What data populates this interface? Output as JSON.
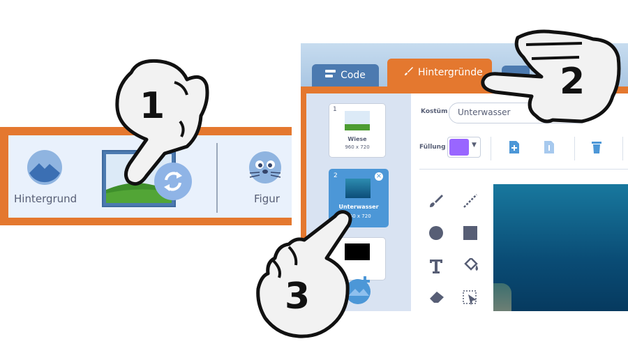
{
  "left_panel": {
    "backdrop_label": "Hintergrund",
    "sprite_label": "Figur"
  },
  "tabs": {
    "code": "Code",
    "backdrops": "Hintergründe"
  },
  "costumes": [
    {
      "number": "1",
      "name": "Wiese",
      "size": "960 x 720"
    },
    {
      "number": "2",
      "name": "Unterwasser",
      "size": "960 x 720"
    },
    {
      "number": "3",
      "name": "",
      "size": ""
    }
  ],
  "editor": {
    "costume_label": "Kostüm",
    "costume_name": "Unterwasser",
    "fill_label": "Füllung",
    "fill_color": "#9966ff"
  },
  "steps": [
    "1",
    "2",
    "3"
  ],
  "colors": {
    "orange": "#e4782f",
    "tab_blue": "#4c7ab0",
    "panel_blue": "#e9f1fc",
    "selected_blue": "#4c97d7"
  }
}
